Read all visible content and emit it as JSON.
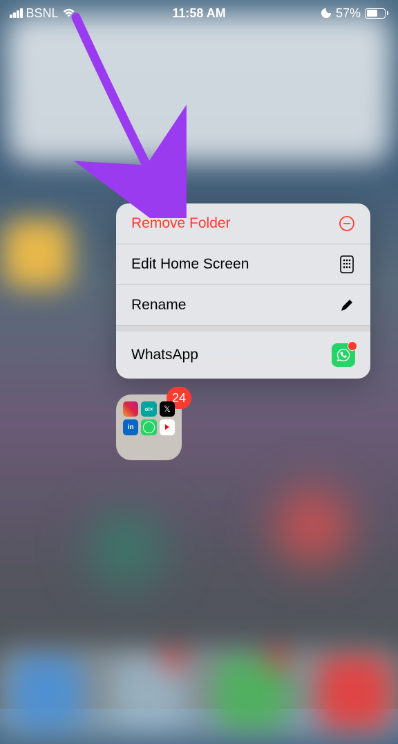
{
  "status": {
    "carrier": "BSNL",
    "time": "11:58 AM",
    "battery_pct": "57%"
  },
  "menu": {
    "remove": "Remove Folder",
    "edit": "Edit Home Screen",
    "rename": "Rename",
    "whatsapp": "WhatsApp"
  },
  "folder": {
    "badge": "24",
    "apps": [
      "instagram",
      "olx",
      "x",
      "linkedin",
      "whatsapp",
      "youtube"
    ]
  },
  "colors": {
    "destructive": "#ff3b30",
    "arrow": "#9b3bf0"
  }
}
